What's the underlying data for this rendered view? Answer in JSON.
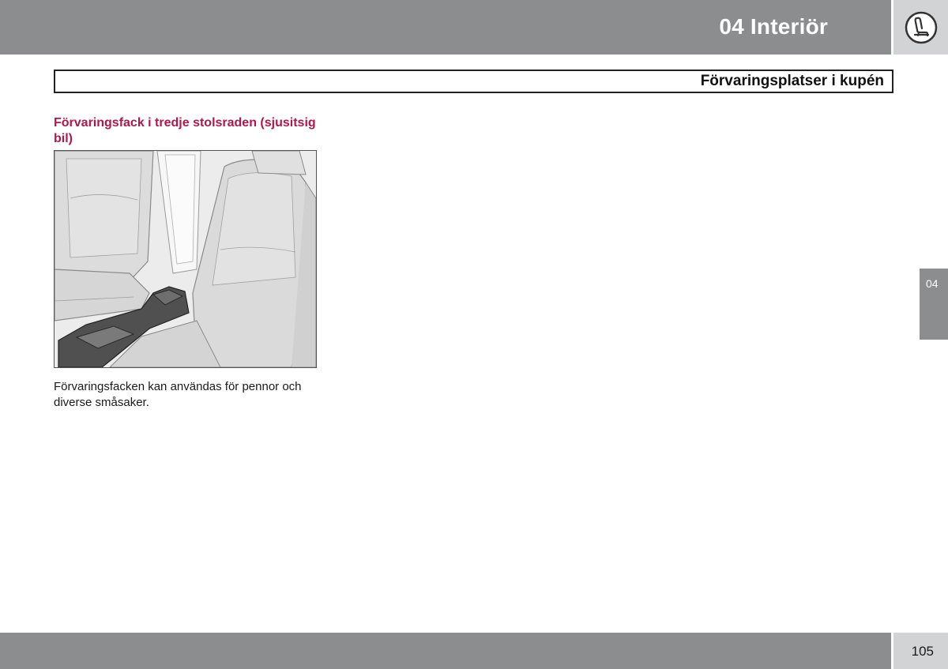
{
  "header": {
    "chapter_title": "04 Interiör",
    "chapter_icon": "seat-icon"
  },
  "section": {
    "title": "Förvaringsplatser i kupén"
  },
  "content": {
    "subheading": "Förvaringsfack i tredje stolsraden (sjusitsig bil)",
    "figure_subject": "third-row-seat-storage-illustration",
    "body": "Förvaringsfacken kan användas för pennor och diverse småsaker."
  },
  "side_tab": {
    "label": "04"
  },
  "footer": {
    "page_number": "105"
  },
  "colors": {
    "bar_gray": "#8c8d8f",
    "light_gray": "#d2d3d5",
    "heading_red": "#b0174a"
  }
}
